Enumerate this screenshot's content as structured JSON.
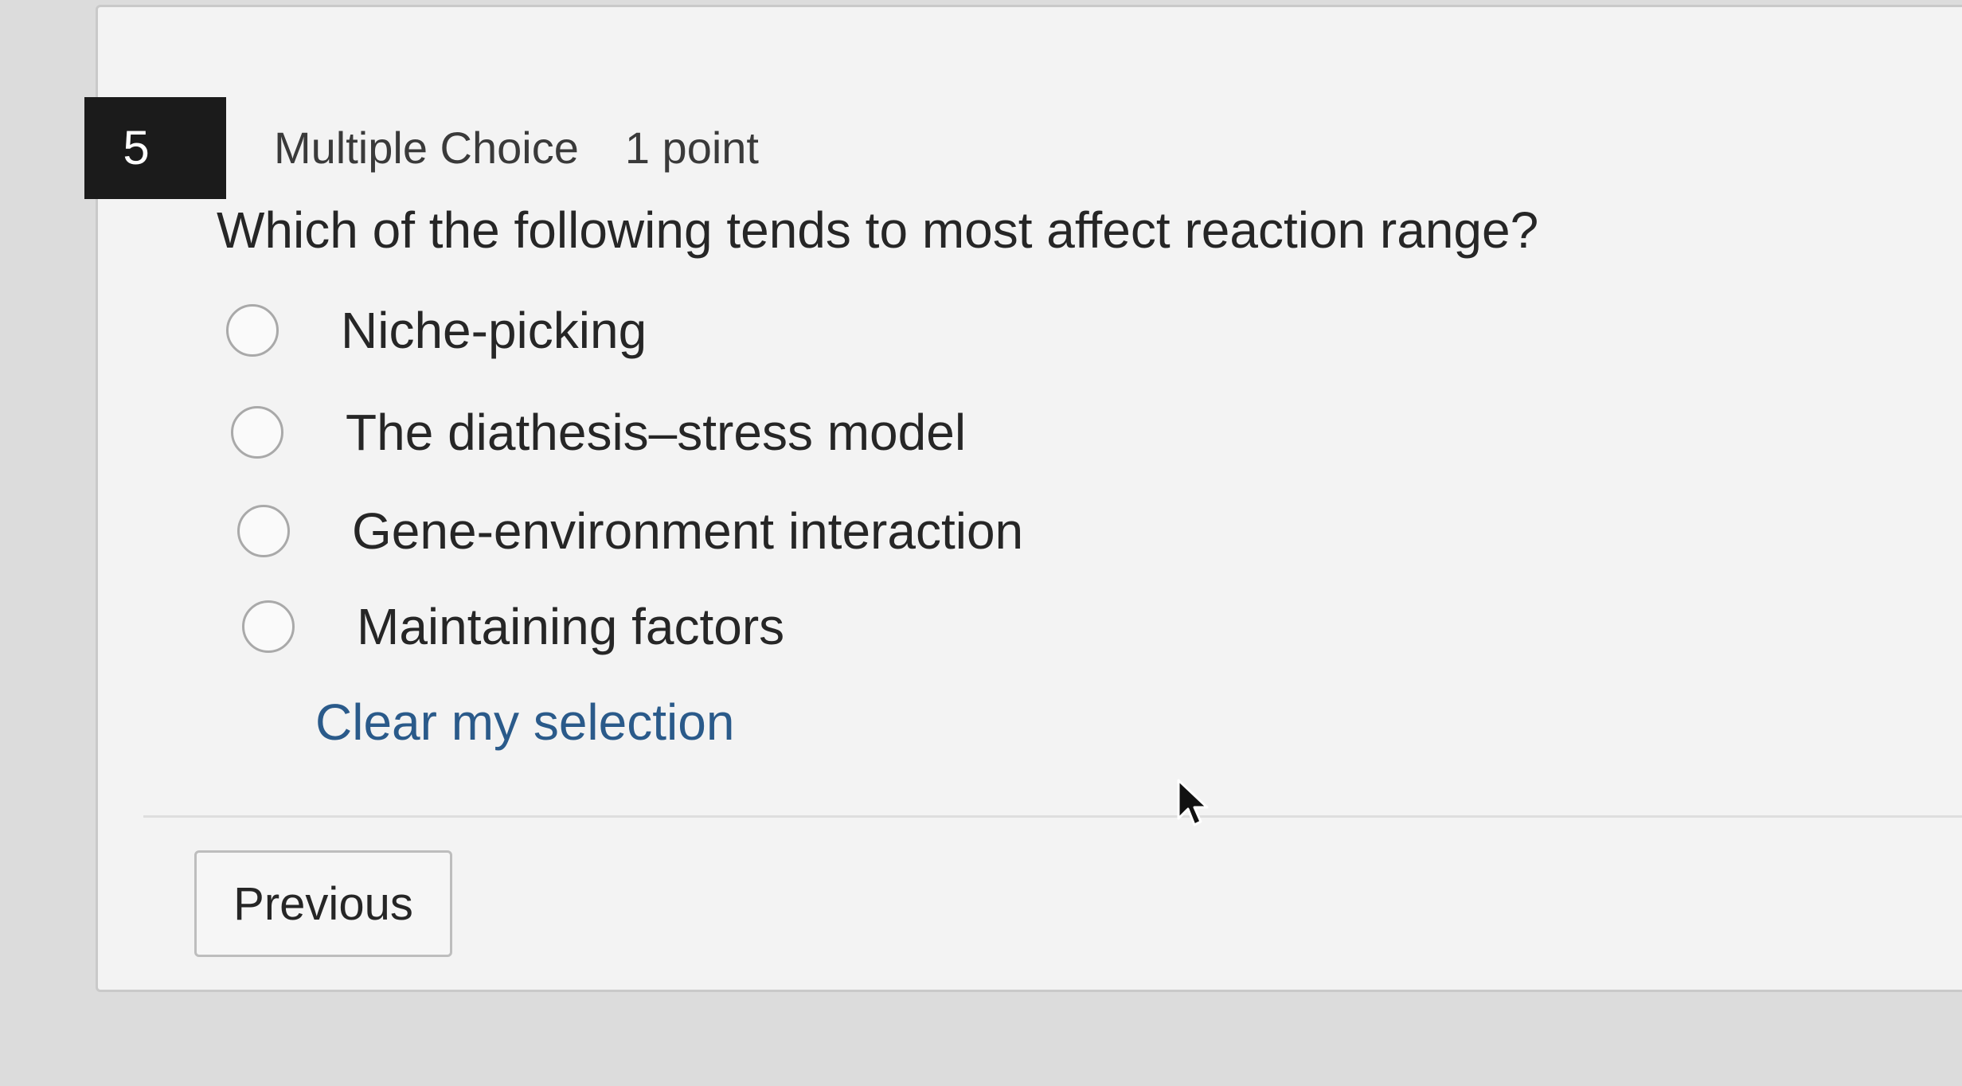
{
  "question": {
    "number": "5",
    "type": "Multiple Choice",
    "points": "1 point",
    "text": "Which of the following tends to most affect reaction range?",
    "options": [
      {
        "label": "Niche-picking",
        "selected": false
      },
      {
        "label": "The diathesis–stress model",
        "selected": false
      },
      {
        "label": "Gene-environment interaction",
        "selected": false
      },
      {
        "label": "Maintaining factors",
        "selected": false
      }
    ],
    "clear_label": "Clear my selection"
  },
  "navigation": {
    "previous_label": "Previous"
  },
  "colors": {
    "badge_bg": "#1b1b1b",
    "link": "#2a5a8a",
    "card_bg": "#f3f3f3"
  },
  "icons": {
    "cursor": "mouse-pointer-icon"
  }
}
